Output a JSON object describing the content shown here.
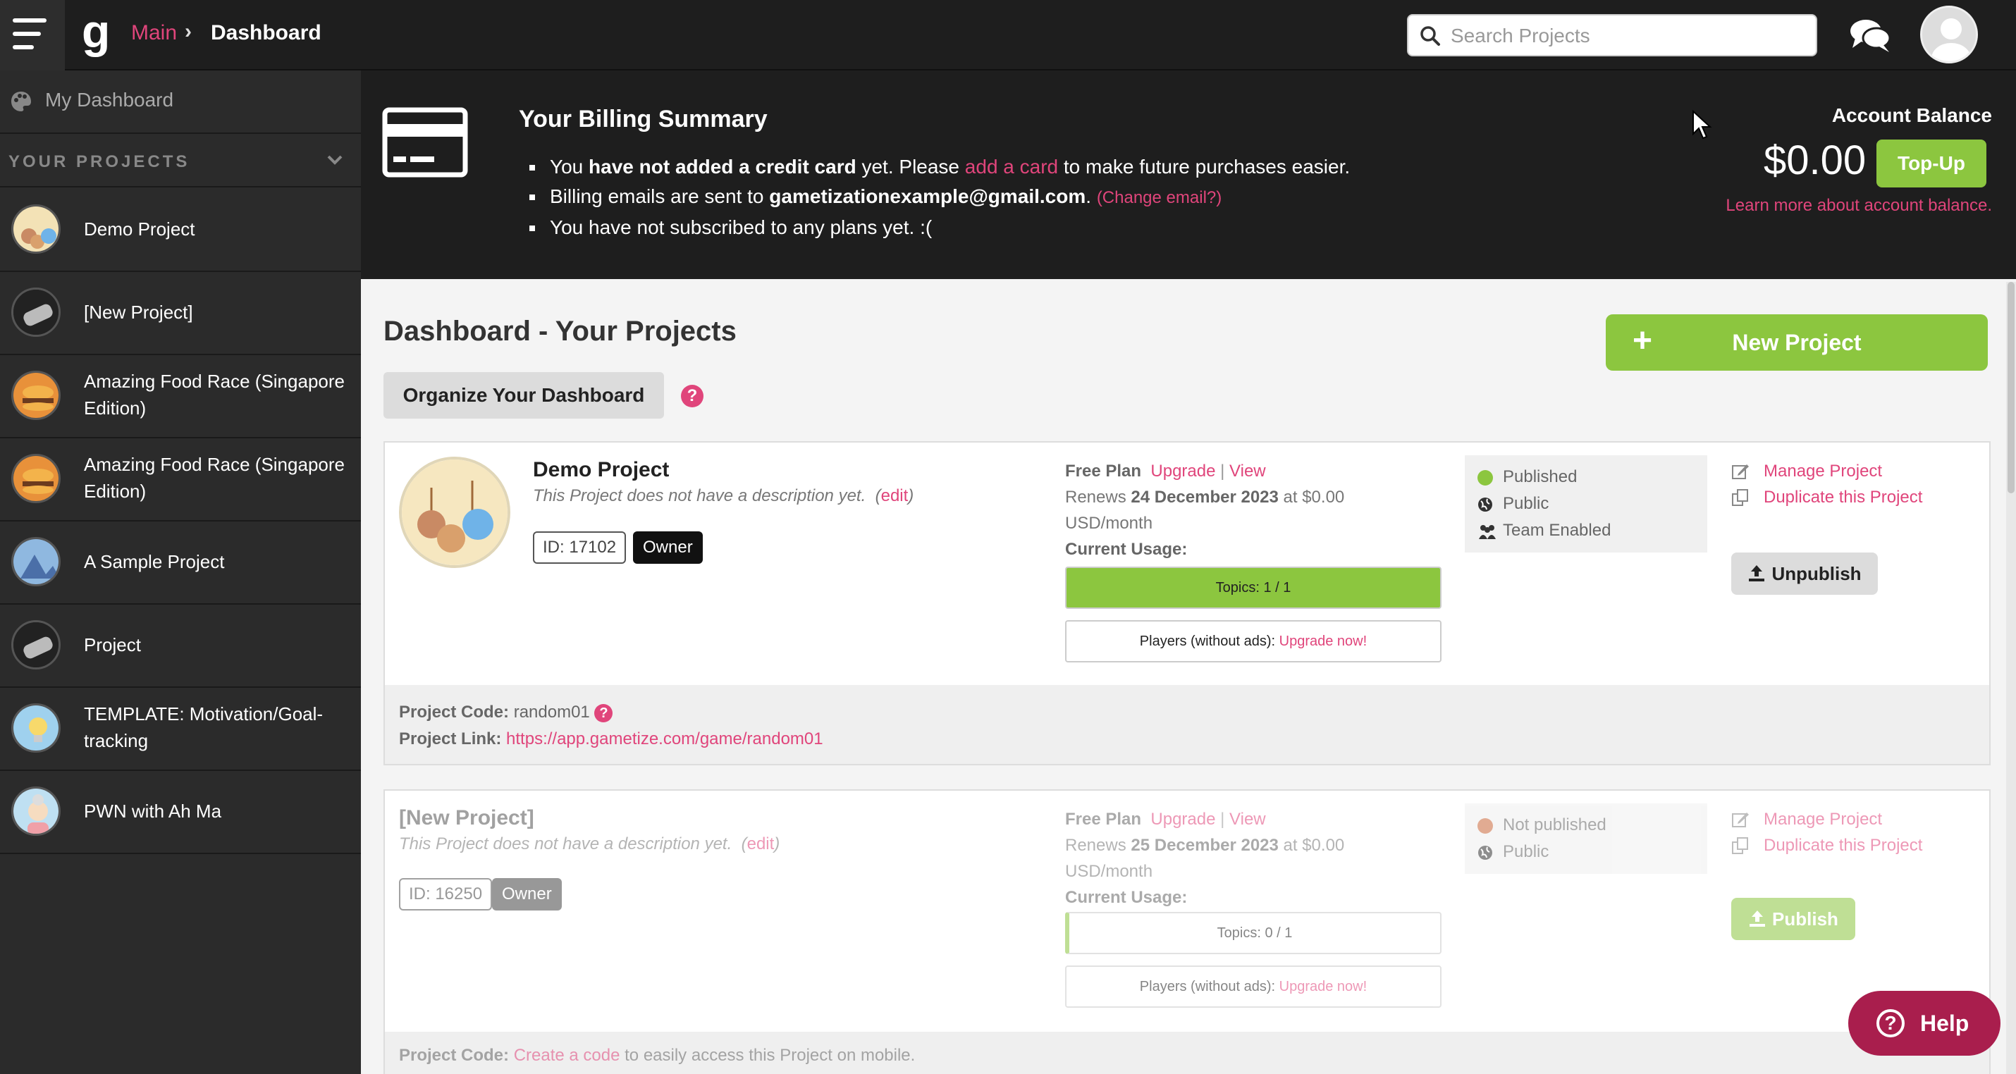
{
  "topbar": {
    "breadcrumb_main": "Main",
    "breadcrumb_current": "Dashboard",
    "search_placeholder": "Search Projects"
  },
  "sidebar": {
    "my_dashboard": "My Dashboard",
    "your_projects": "YOUR PROJECTS",
    "projects": [
      {
        "name": "Demo Project",
        "icon": "candy-apples-icon"
      },
      {
        "name": "[New Project]",
        "icon": "gamepad-icon"
      },
      {
        "name": "Amazing Food Race (Singapore Edition)",
        "icon": "burger-icon"
      },
      {
        "name": "Amazing Food Race (Singapore Edition)",
        "icon": "burger-icon"
      },
      {
        "name": "A Sample Project",
        "icon": "landscape-icon"
      },
      {
        "name": "Project",
        "icon": "gamepad-icon"
      },
      {
        "name": "TEMPLATE: Motivation/Goal-tracking",
        "icon": "lightbulb-icon"
      },
      {
        "name": "PWN with Ah Ma",
        "icon": "grandma-icon"
      }
    ]
  },
  "billing": {
    "title": "Your Billing Summary",
    "line1_a": "You ",
    "line1_b": "have not added a credit card",
    "line1_c": " yet. Please ",
    "line1_link": "add a card",
    "line1_d": " to make future purchases easier.",
    "line2_a": "Billing emails are sent to ",
    "line2_email": "gametizationexample@gmail.com",
    "line2_b": ". ",
    "line2_link": "(Change email?)",
    "line3": "You have not subscribed to any plans yet. :(",
    "account_title": "Account Balance",
    "balance": "$0.00",
    "topup": "Top-Up",
    "learn_more": "Learn more about account balance."
  },
  "main": {
    "title": "Dashboard - Your Projects",
    "organize": "Organize Your Dashboard",
    "new_project": "New Project",
    "help_q": "?"
  },
  "cards": [
    {
      "title": "Demo Project",
      "desc": "This Project does not have a description yet.",
      "edit": "edit",
      "id": "ID: 17102",
      "owner": "Owner",
      "plan": "Free Plan",
      "upgrade": "Upgrade",
      "view": "View",
      "renews_a": "Renews ",
      "renews_date": "24 December 2023",
      "renews_b": " at $0.00",
      "renews_c": "USD/month",
      "current_usage": "Current Usage:",
      "topics": "Topics: 1 / 1",
      "topics_fill": 1.0,
      "players": "Players (without ads): ",
      "upgrade_now": "Upgrade now!",
      "status": [
        "Published",
        "Public",
        "Team Enabled"
      ],
      "manage": "Manage Project",
      "duplicate": "Duplicate this Project",
      "pub_btn": "Unpublish",
      "code_label": "Project Code:",
      "code_value": "random01",
      "link_label": "Project Link:",
      "link_value": "https://app.gametize.com/game/random01"
    },
    {
      "title": "[New Project]",
      "desc": "This Project does not have a description yet.",
      "edit": "edit",
      "id": "ID: 16250",
      "owner": "Owner",
      "plan": "Free Plan",
      "upgrade": "Upgrade",
      "view": "View",
      "renews_a": "Renews ",
      "renews_date": "25 December 2023",
      "renews_b": " at $0.00",
      "renews_c": "USD/month",
      "current_usage": "Current Usage:",
      "topics": "Topics: 0 / 1",
      "topics_fill": 0.0,
      "players": "Players (without ads): ",
      "upgrade_now": "Upgrade now!",
      "status": [
        "Not published",
        "Public"
      ],
      "manage": "Manage Project",
      "duplicate": "Duplicate this Project",
      "pub_btn": "Publish",
      "code_label": "Project Code:",
      "code_link": "Create a code",
      "code_rest": " to easily access this Project on mobile."
    }
  ],
  "help": "Help",
  "colors": {
    "accent_pink": "#e0457b",
    "green": "#8cc63f",
    "dark": "#1e1e1e",
    "help_button": "#a91e4d"
  }
}
